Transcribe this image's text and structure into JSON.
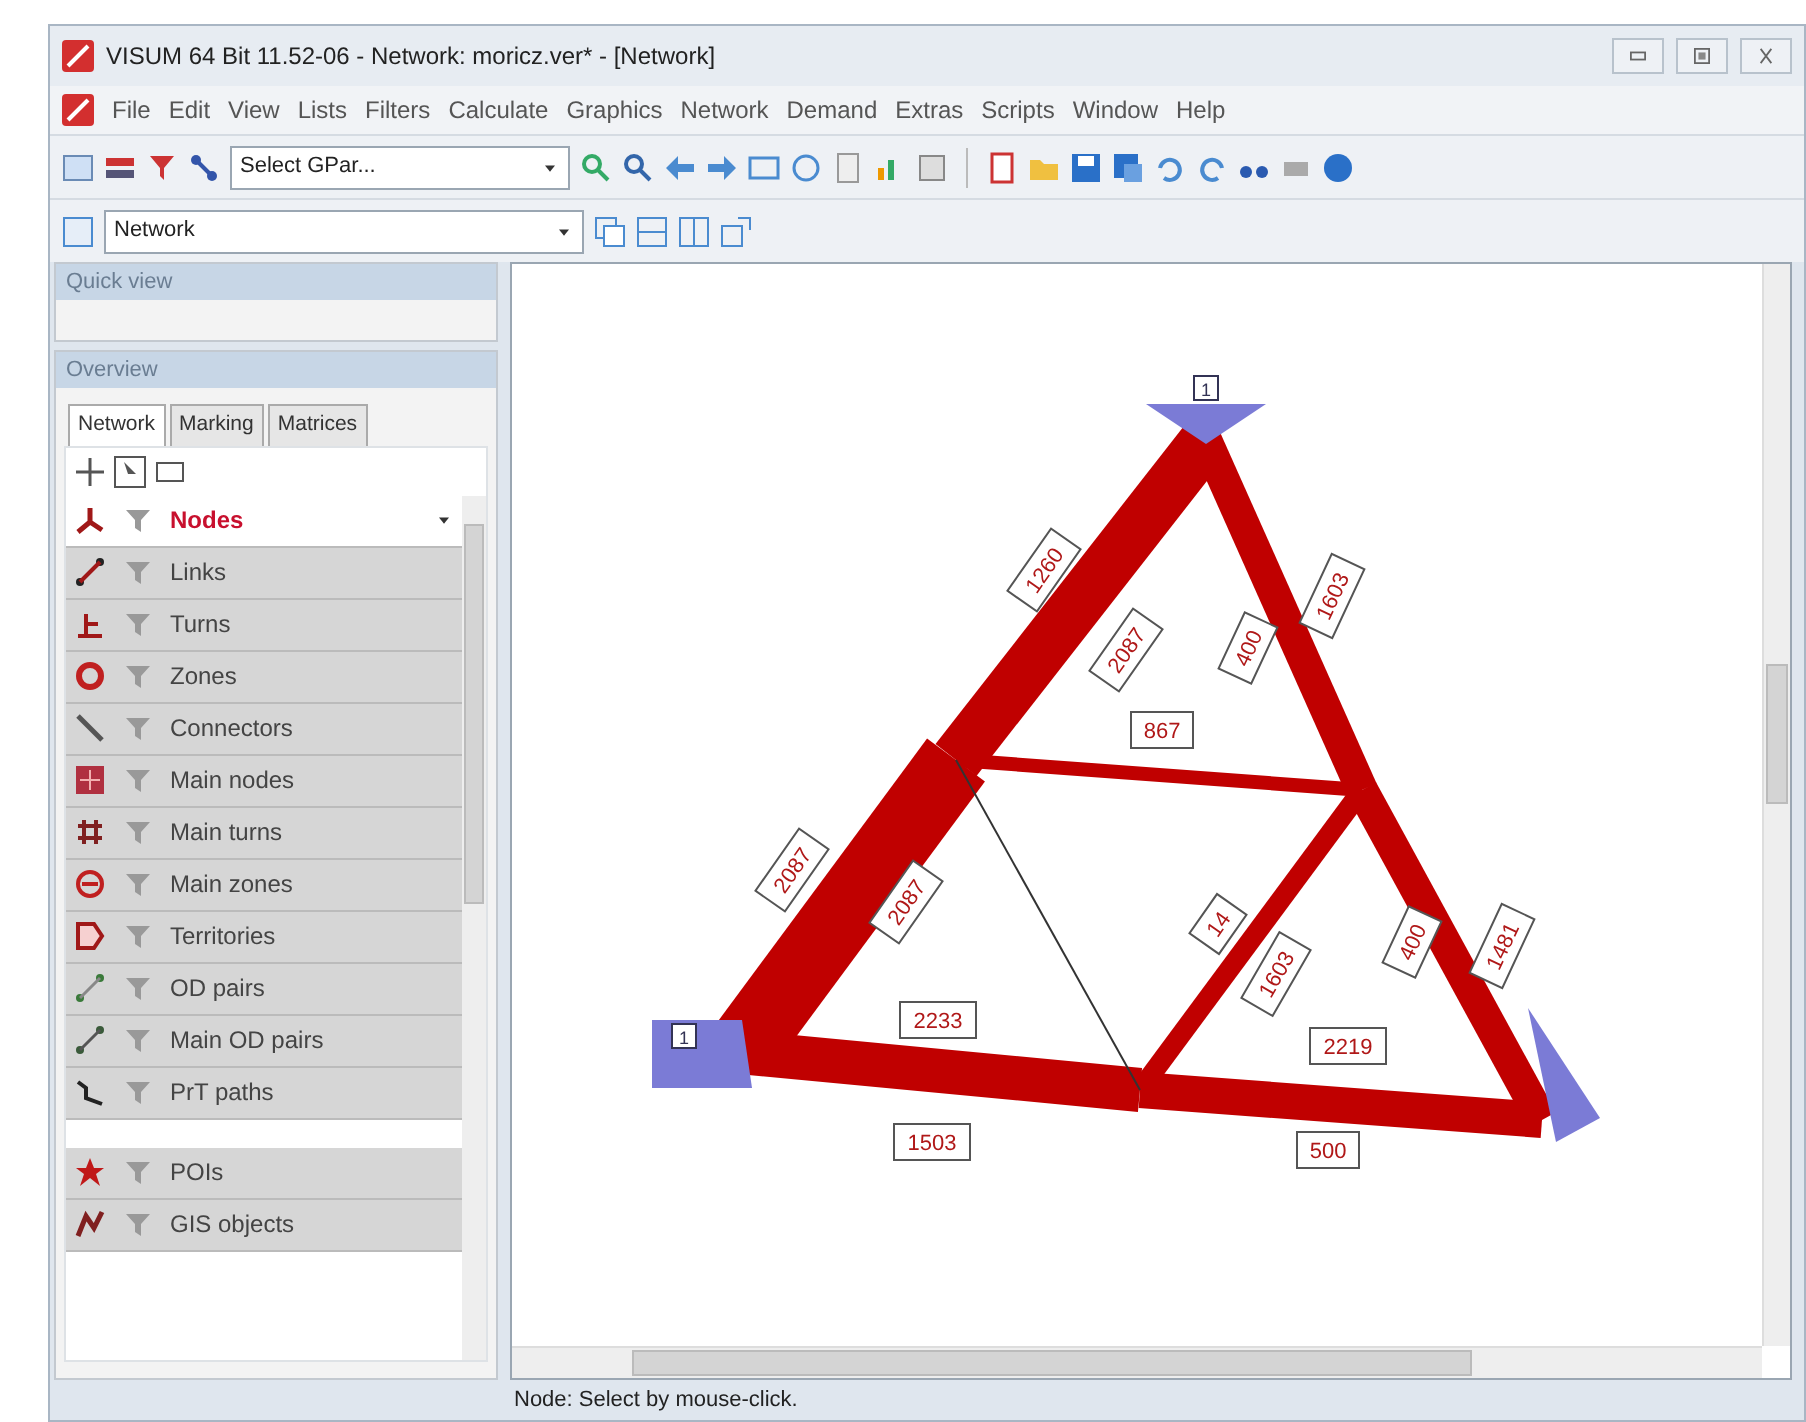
{
  "window": {
    "title": "VISUM 64 Bit 11.52-06 - Network: moricz.ver* - [Network]"
  },
  "menu": [
    "File",
    "Edit",
    "View",
    "Lists",
    "Filters",
    "Calculate",
    "Graphics",
    "Network",
    "Demand",
    "Extras",
    "Scripts",
    "Window",
    "Help"
  ],
  "toolbar": {
    "gpar_select": "Select GPar...",
    "view_select": "Network"
  },
  "quick_view": {
    "title": "Quick view"
  },
  "overview": {
    "title": "Overview",
    "tabs": [
      {
        "label": "Network",
        "selected": true
      },
      {
        "label": "Marking",
        "selected": false
      },
      {
        "label": "Matrices",
        "selected": false
      }
    ],
    "items": [
      {
        "label": "Nodes",
        "selected": true
      },
      {
        "label": "Links",
        "selected": false
      },
      {
        "label": "Turns",
        "selected": false
      },
      {
        "label": "Zones",
        "selected": false
      },
      {
        "label": "Connectors",
        "selected": false
      },
      {
        "label": "Main nodes",
        "selected": false
      },
      {
        "label": "Main turns",
        "selected": false
      },
      {
        "label": "Main zones",
        "selected": false
      },
      {
        "label": "Territories",
        "selected": false
      },
      {
        "label": "OD pairs",
        "selected": false
      },
      {
        "label": "Main OD pairs",
        "selected": false
      },
      {
        "label": "PrT paths",
        "selected": false
      }
    ],
    "items_2": [
      {
        "label": "POIs",
        "selected": false
      },
      {
        "label": "GIS objects",
        "selected": false
      }
    ]
  },
  "network": {
    "zone_labels": [
      "1",
      "1"
    ],
    "link_labels": [
      "1260",
      "2087",
      "400",
      "1603",
      "867",
      "2087",
      "2087",
      "2233",
      "14",
      "1603",
      "400",
      "1481",
      "2219",
      "1503",
      "500"
    ]
  },
  "status_bar": "Node: Select by mouse-click."
}
